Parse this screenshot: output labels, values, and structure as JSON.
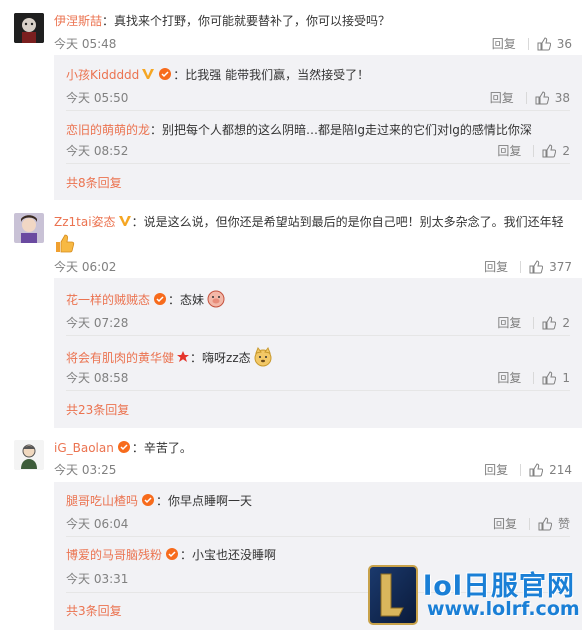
{
  "comments": [
    {
      "username": "伊涅斯喆",
      "text": "：真找来个打野，你可能就要替补了，你可以接受吗？",
      "time": "今天 05:48",
      "reply_label": "回复",
      "likes": "36",
      "replies": [
        {
          "username": "小孩Kiddddd",
          "text": "：比我强 能带我们赢，当然接受了！",
          "time": "今天 05:50",
          "reply_label": "回复",
          "likes": "38"
        },
        {
          "username": "恋旧的萌萌的龙",
          "text": "：别把每个人都想的这么阴暗…都是陪lg走过来的它们对lg的感情比你深",
          "time": "今天 08:52",
          "reply_label": "回复",
          "likes": "2"
        }
      ],
      "more": "共8条回复"
    },
    {
      "username": "Zz1tai姿态",
      "text": "：说是这么说，但你还是希望站到最后的是你自己吧！别太多杂念了。我们还年轻",
      "time": "今天 06:02",
      "reply_label": "回复",
      "likes": "377",
      "replies": [
        {
          "username": "花一样的贼贼态",
          "text": "：态妹",
          "time": "今天 07:28",
          "reply_label": "回复",
          "likes": "2"
        },
        {
          "username": "将会有肌肉的黄华健",
          "text": "：嗨呀zz态",
          "time": "今天 08:58",
          "reply_label": "回复",
          "likes": "1"
        }
      ],
      "more": "共23条回复"
    },
    {
      "username": "iG_Baolan",
      "text": "：辛苦了。",
      "time": "今天 03:25",
      "reply_label": "回复",
      "likes": "214",
      "replies": [
        {
          "username": "腿哥吃山楂吗",
          "text": "：你早点睡啊一天",
          "time": "今天 06:04",
          "reply_label": "回复",
          "likes": "赞"
        },
        {
          "username": "博爱的马哥脑残粉",
          "text": "：小宝也还没睡啊",
          "time": "今天 03:31",
          "reply_label": "回复",
          "likes": ""
        }
      ],
      "more": "共3条回复"
    }
  ],
  "watermark": {
    "title": "lol日服官网",
    "url": "www.lolrf.com"
  },
  "colors": {
    "username": "#eb7350",
    "meta": "#808080",
    "subbox": "#f2f2f5"
  }
}
